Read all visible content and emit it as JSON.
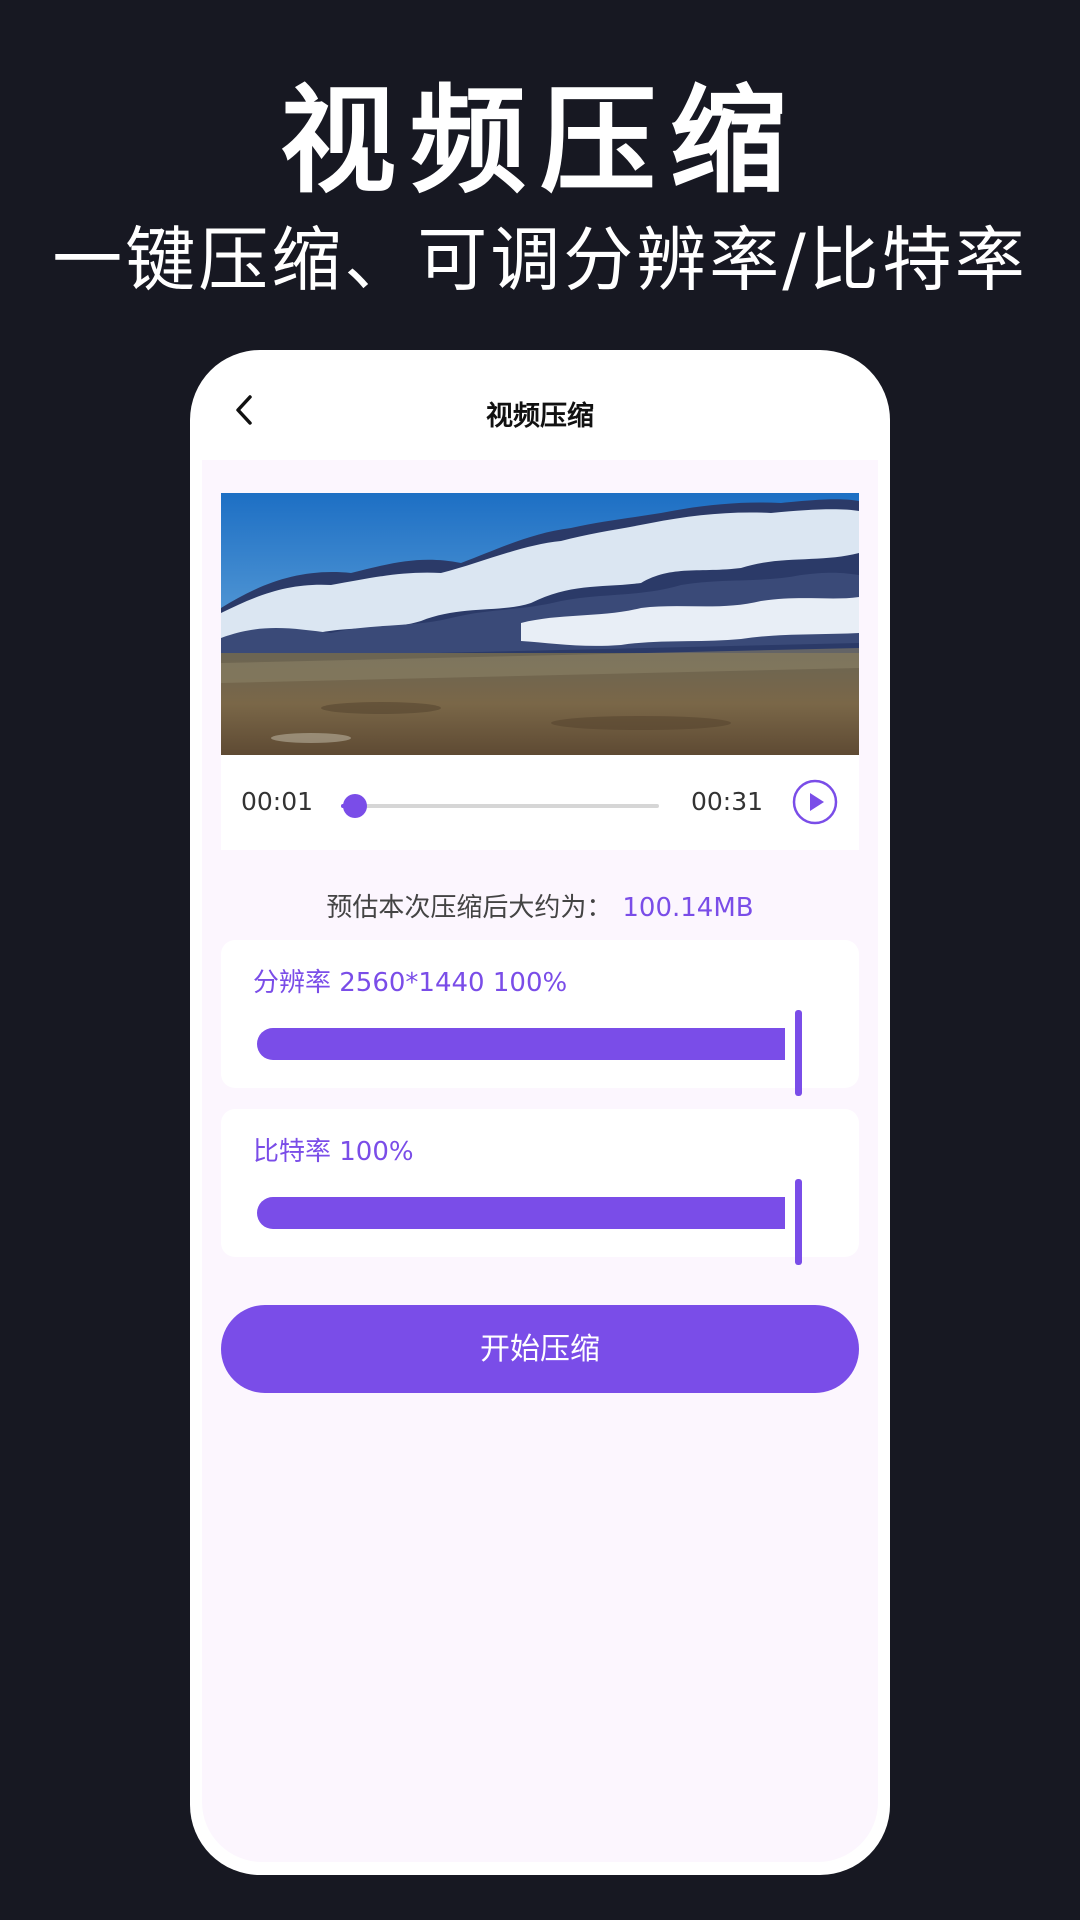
{
  "promo": {
    "title": "视频压缩",
    "subtitle": "一键压缩、可调分辨率/比特率"
  },
  "nav": {
    "back_icon": "chevron-left-icon",
    "title": "视频压缩"
  },
  "player": {
    "current_time": "00:01",
    "total_time": "00:31",
    "progress_fraction": 0.03,
    "play_icon": "play-circle-icon"
  },
  "estimate": {
    "label": "预估本次压缩后大约为：",
    "value": "100.14MB"
  },
  "resolution": {
    "label": "分辨率 2560*1440 100%",
    "percent": 100
  },
  "bitrate": {
    "label": "比特率 100%",
    "percent": 100
  },
  "actions": {
    "start_label": "开始压缩"
  },
  "colors": {
    "accent": "#7a4de8",
    "background": "#171822",
    "surface": "#fcf6fe"
  }
}
